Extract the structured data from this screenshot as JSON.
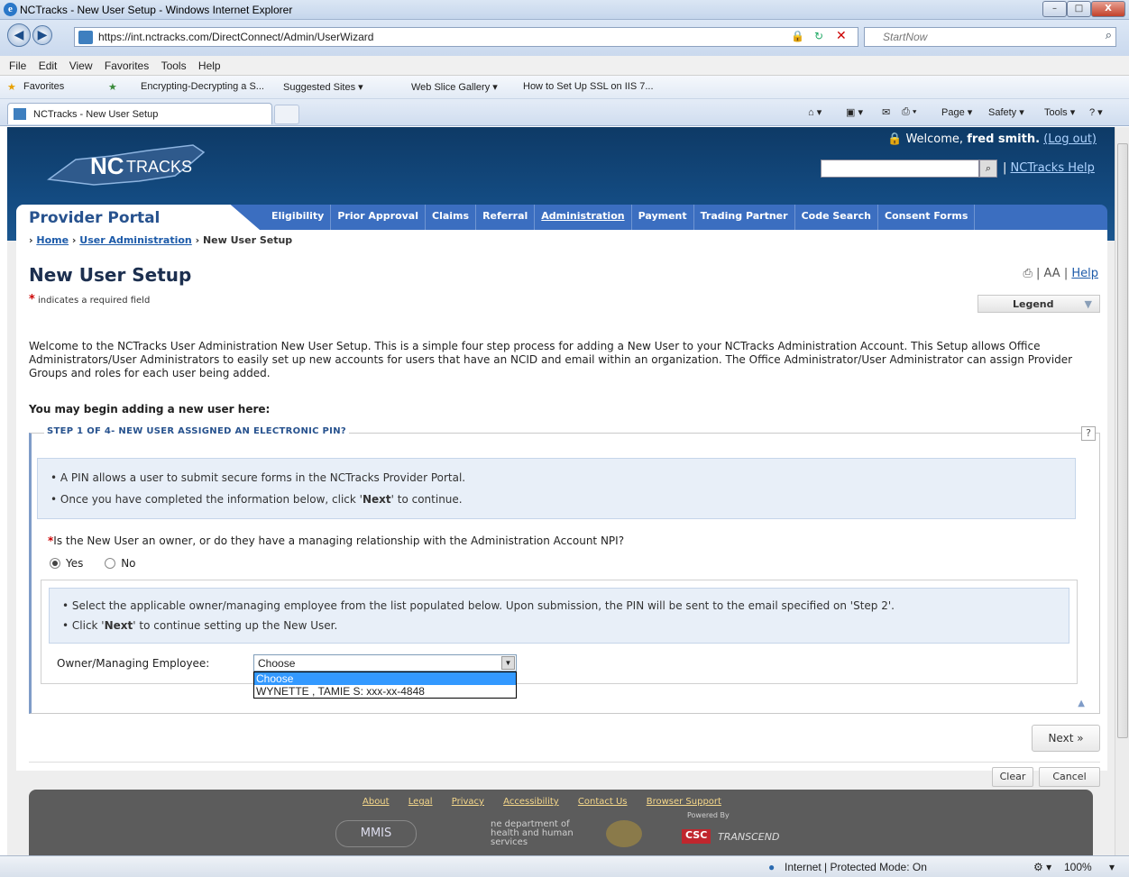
{
  "browser": {
    "window_title": "NCTracks - New User Setup - Windows Internet Explorer",
    "url": "https://int.nctracks.com/DirectConnect/Admin/UserWizard",
    "search_placeholder": "StartNow",
    "menu": [
      "File",
      "Edit",
      "View",
      "Favorites",
      "Tools",
      "Help"
    ],
    "favorites_label": "Favorites",
    "favorites_links": [
      "Encrypting-Decrypting a S...",
      "Suggested Sites ▾",
      "Web Slice Gallery ▾",
      "How to Set Up SSL on IIS 7..."
    ],
    "tab_title": "NCTracks - New User Setup",
    "tools": [
      "Page ▾",
      "Safety ▾",
      "Tools ▾"
    ],
    "status_zone": "Internet | Protected Mode: On",
    "zoom": "100%"
  },
  "header": {
    "welcome_prefix": "Welcome,",
    "user_name": "fred smith.",
    "logout": "(Log out)",
    "help": "NCTracks Help"
  },
  "nav": {
    "portal_title": "Provider Portal",
    "items": [
      "Eligibility",
      "Prior Approval",
      "Claims",
      "Referral",
      "Administration",
      "Payment",
      "Trading Partner",
      "Code Search",
      "Consent Forms"
    ]
  },
  "breadcrumb": {
    "home": "Home",
    "user_admin": "User Administration",
    "current": "New User Setup"
  },
  "page": {
    "title": "New User Setup",
    "required_note": "indicates a required field",
    "help": "Help",
    "text_size": "AA",
    "legend": "Legend",
    "intro": "Welcome to the NCTracks User Administration New User Setup. This is a simple four step process for adding a New User to your NCTracks Administration Account. This Setup allows Office Administrators/User Administrators to easily set up new accounts for users that have an NCID and email within an organization. The Office Administrator/User Administrator can assign Provider Groups and roles for each user being added.",
    "begin": "You may begin adding a new user here:"
  },
  "step": {
    "legend": "STEP 1 OF 4- NEW USER ASSIGNED AN ELECTRONIC PIN?",
    "help_mark": "?",
    "info1": "• A PIN allows a user to submit secure forms in the NCTracks Provider Portal.",
    "info2_pre": "• Once you have completed the information below, click '",
    "info2_bold": "Next",
    "info2_post": "' to continue.",
    "question": "Is the New User an owner, or do they have a managing relationship with the Administration Account NPI?",
    "yes": "Yes",
    "no": "No",
    "selected": "Yes",
    "info3": "• Select the applicable owner/managing employee from the list populated below. Upon submission, the PIN will be sent to the email specified on 'Step 2'.",
    "info4_pre": "• Click '",
    "info4_bold": "Next",
    "info4_post": "' to continue setting up the New User.",
    "owner_label": "Owner/Managing Employee:",
    "owner_value": "Choose",
    "owner_options": [
      "Choose",
      "WYNETTE , TAMIE S: xxx-xx-4848"
    ]
  },
  "buttons": {
    "next": "Next »",
    "clear": "Clear",
    "cancel": "Cancel"
  },
  "footer": {
    "links": [
      "About",
      "Legal",
      "Privacy",
      "Accessibility",
      "Contact Us",
      "Browser Support"
    ],
    "logos": [
      "MMIS",
      "ne department of health and human services",
      "Powered By",
      "CSC",
      "TRANSCEND"
    ]
  }
}
